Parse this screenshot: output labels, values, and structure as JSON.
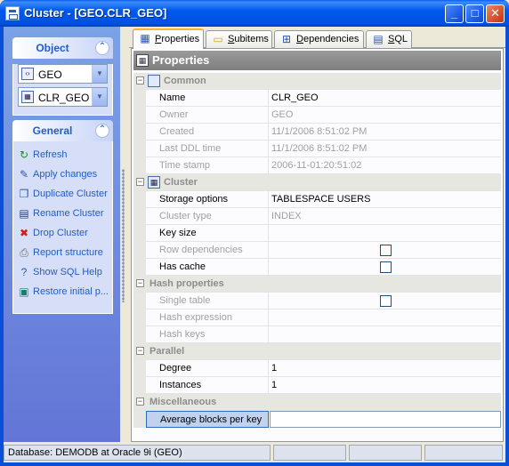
{
  "window": {
    "title": "Cluster - [GEO.CLR_GEO]",
    "min_glyph": "_",
    "max_glyph": "□",
    "close_glyph": "✕"
  },
  "object_panel": {
    "header": "Object",
    "collapse_glyph": "⌃",
    "schema": "GEO",
    "cluster": "CLR_GEO"
  },
  "general_panel": {
    "header": "General",
    "collapse_glyph": "⌃",
    "items": [
      {
        "label": "Refresh",
        "icon": "refresh-icon",
        "glyph": "↻",
        "color": "#1a8c2c"
      },
      {
        "label": "Apply changes",
        "icon": "apply-icon",
        "glyph": "✎",
        "color": "#2a55b0"
      },
      {
        "label": "Duplicate Cluster",
        "icon": "duplicate-icon",
        "glyph": "❐",
        "color": "#2a55b0"
      },
      {
        "label": "Rename Cluster",
        "icon": "rename-icon",
        "glyph": "▤",
        "color": "#2a3f7a"
      },
      {
        "label": "Drop Cluster",
        "icon": "drop-icon",
        "glyph": "✖",
        "color": "#d02010"
      },
      {
        "label": "Report structure",
        "icon": "report-icon",
        "glyph": "⎙",
        "color": "#6a6a6a"
      },
      {
        "label": "Show SQL Help",
        "icon": "help-icon",
        "glyph": "?",
        "color": "#2a55b0"
      },
      {
        "label": "Restore initial p...",
        "icon": "restore-icon",
        "glyph": "▣",
        "color": "#1a7c6c"
      }
    ]
  },
  "tabs": [
    {
      "label": "Properties",
      "acc": "P",
      "rest": "roperties",
      "icon": "properties-icon",
      "glyph": "▦",
      "active": true
    },
    {
      "label": "Subitems",
      "acc": "S",
      "rest": "ubitems",
      "icon": "folder-icon",
      "glyph": "▭",
      "active": false
    },
    {
      "label": "Dependencies",
      "acc": "D",
      "rest": "ependencies",
      "icon": "dependencies-icon",
      "glyph": "⊞",
      "active": false
    },
    {
      "label": "SQL",
      "acc": "S",
      "rest": "QL",
      "icon": "sql-icon",
      "glyph": "▤",
      "active": false
    }
  ],
  "properties": {
    "header": "Properties",
    "rows": [
      {
        "type": "cat",
        "label": "Common",
        "icon": "common-icon"
      },
      {
        "type": "prop",
        "name": "Name",
        "value": "CLR_GEO",
        "disabled": false
      },
      {
        "type": "prop",
        "name": "Owner",
        "value": "GEO",
        "disabled": true
      },
      {
        "type": "prop",
        "name": "Created",
        "value": "11/1/2006 8:51:02 PM",
        "disabled": true
      },
      {
        "type": "prop",
        "name": "Last DDL time",
        "value": "11/1/2006 8:51:02 PM",
        "disabled": true
      },
      {
        "type": "prop",
        "name": "Time stamp",
        "value": "2006-11-01:20:51:02",
        "disabled": true
      },
      {
        "type": "cat",
        "label": "Cluster",
        "icon": "cluster-icon"
      },
      {
        "type": "prop",
        "name": "Storage options",
        "value": "TABLESPACE USERS",
        "disabled": false
      },
      {
        "type": "prop",
        "name": "Cluster type",
        "value": "INDEX",
        "disabled": true
      },
      {
        "type": "prop",
        "name": "Key size",
        "value": "",
        "disabled": false
      },
      {
        "type": "check",
        "name": "Row dependencies",
        "checked": false,
        "disabled": true
      },
      {
        "type": "check",
        "name": "Has cache",
        "checked": false,
        "disabled": false
      },
      {
        "type": "cat",
        "label": "Hash properties"
      },
      {
        "type": "check",
        "name": "Single table",
        "checked": false,
        "disabled": true
      },
      {
        "type": "prop",
        "name": "Hash expression",
        "value": "",
        "disabled": true
      },
      {
        "type": "prop",
        "name": "Hash keys",
        "value": "",
        "disabled": true
      },
      {
        "type": "cat",
        "label": "Parallel"
      },
      {
        "type": "prop",
        "name": "Degree",
        "value": "1",
        "disabled": false
      },
      {
        "type": "prop",
        "name": "Instances",
        "value": "1",
        "disabled": false
      },
      {
        "type": "cat",
        "label": "Miscellaneous"
      },
      {
        "type": "prop",
        "name": "Average blocks per key",
        "value": "",
        "disabled": false,
        "selected": true
      }
    ]
  },
  "status": {
    "database": "Database: DEMODB  at Oracle 9i (GEO)"
  }
}
